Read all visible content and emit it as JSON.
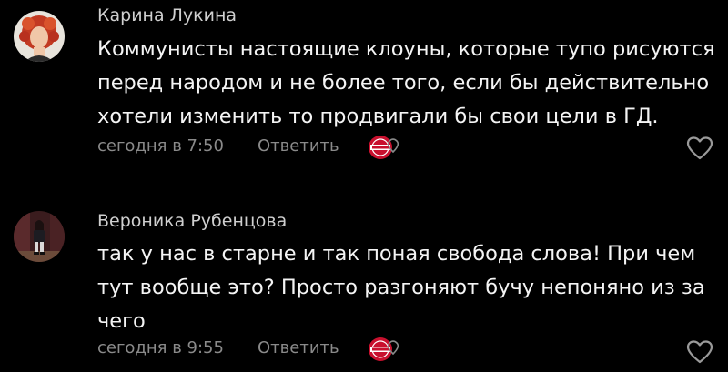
{
  "comments": [
    {
      "author": "Карина Лукина",
      "lines": [
        "Коммунисты настоящие клоуны, которые тупо рисуются",
        "перед народом и не более того, если бы действительно",
        "хотели изменить то продвигали бы свои цели в ГД."
      ],
      "time": "сегодня в 7:50",
      "reply_label": "Ответить"
    },
    {
      "author": "Вероника Рубенцова",
      "lines": [
        "так у нас в старне и так поная свобода слова! При чем",
        "тут вообще это? Просто разгоняют бучу непоняно из за",
        "чего"
      ],
      "time": "сегодня в 9:55",
      "reply_label": "Ответить"
    }
  ],
  "icons": {
    "like": "heart-outline-icon",
    "sticker": "reaction-sticker-icon"
  },
  "colors": {
    "background": "#000000",
    "author": "#cfcfcf",
    "text": "#f4f4f4",
    "meta": "#8a8a8a",
    "sticker_red": "#c8102e"
  }
}
